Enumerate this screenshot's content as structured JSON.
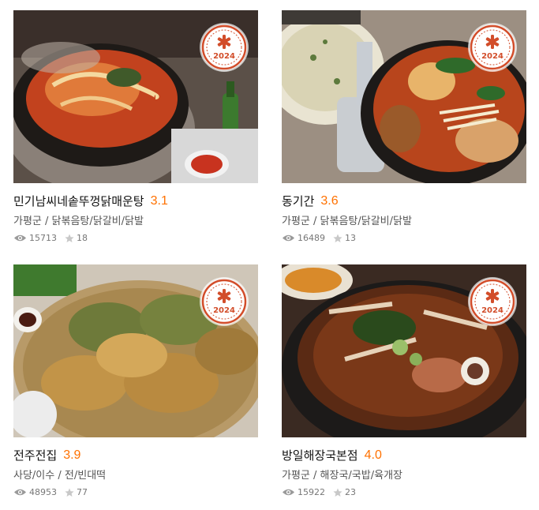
{
  "badge": {
    "year": "2024",
    "color": "#d24d2a"
  },
  "cards": [
    {
      "name": "민기남씨네솥뚜껑닭매운탕",
      "rating": "3.1",
      "region": "가평군",
      "category": "닭볶음탕/닭갈비/닭발",
      "views": "15713",
      "likes": "18",
      "image_desc": "spicy-chicken-stew-in-cauldron"
    },
    {
      "name": "동기간",
      "rating": "3.6",
      "region": "가평군",
      "category": "닭볶음탕/닭갈비/닭발",
      "views": "16489",
      "likes": "13",
      "image_desc": "braised-chicken-with-pancake"
    },
    {
      "name": "전주전집",
      "rating": "3.9",
      "region": "사당/이수",
      "category": "전/빈대떡",
      "views": "48953",
      "likes": "77",
      "image_desc": "korean-pancakes-on-basket"
    },
    {
      "name": "방일해장국본점",
      "rating": "4.0",
      "region": "가평군",
      "category": "해장국/국밥/육개장",
      "views": "15922",
      "likes": "23",
      "image_desc": "hangover-soup-in-stone-pot"
    }
  ]
}
